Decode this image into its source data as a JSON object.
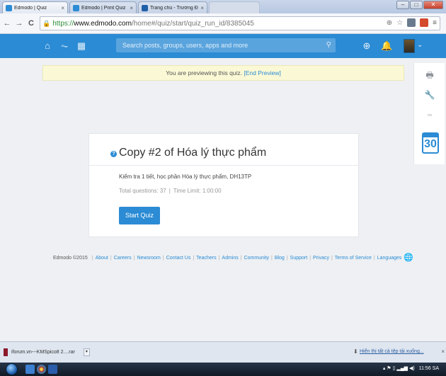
{
  "browser": {
    "tabs": [
      {
        "title": "Edmodo | Quiz",
        "close": "×",
        "active": true
      },
      {
        "title": "Edmodo | Print Quiz",
        "close": "×",
        "active": false
      },
      {
        "title": "Trang chủ - Trường Đại học",
        "close": "×",
        "active": false
      }
    ],
    "window_controls": {
      "minimize": "–",
      "maximize": "□",
      "close": "✕"
    },
    "url": {
      "lock": "🔒",
      "scheme": "https://",
      "host": "www.edmodo.com",
      "path": "/home#/quiz/start/quiz_run_id/8385045"
    },
    "nav": {
      "back": "←",
      "forward": "→",
      "reload": "C",
      "home": "⌂"
    },
    "url_right": {
      "zoom": "⊕",
      "star": "☆"
    }
  },
  "appbar": {
    "icons": {
      "home": "⌂",
      "progress": "⏦",
      "library": "▦",
      "backpack": "⊕",
      "bell": "🔔"
    },
    "search_placeholder": "Search posts, groups, users, apps and more",
    "search_icon": "⚲",
    "avatar_caret": "⌄",
    "color": "#2b8bd4"
  },
  "banner": {
    "text": "You are previewing this quiz. ",
    "link": "[End Preview]"
  },
  "rail": {
    "icons": [
      "printer-icon",
      "wrench-icon",
      "apps-grid-icon"
    ],
    "glyphs": [
      "🖶",
      "🔧",
      "▫▫"
    ],
    "calendar_day": "30"
  },
  "quiz": {
    "icon": "?",
    "title": "Copy #2 of Hóa lý thực phẩm",
    "description": "Kiểm tra 1 tiết, học phần Hóa lý thực phẩm, DH13TP",
    "total_questions": "Total questions: 37",
    "separator": "|",
    "time_limit": "Time Limit: 1:00:00",
    "start_button": "Start Quiz"
  },
  "footer": {
    "copyright": "Edmodo ©2015",
    "separator": "|",
    "links": [
      "About",
      "Careers",
      "Newsroom",
      "Contact Us",
      "Teachers",
      "Admins",
      "Community",
      "Blog",
      "Support",
      "Privacy",
      "Terms of Service",
      "Languages"
    ],
    "globe": "🌐"
  },
  "downloads": {
    "item": "iforum.vn---KMSpico8 2....rar",
    "caret": "▾",
    "show_all": "Hiển thị tất cả tệp tải xuống...",
    "show_all_icon": "⬇",
    "close": "×"
  },
  "taskbar": {
    "tray_icons": "▴ ⚑ ▯ ▂▄▆ ◀)",
    "clock": "11:56 SA"
  }
}
